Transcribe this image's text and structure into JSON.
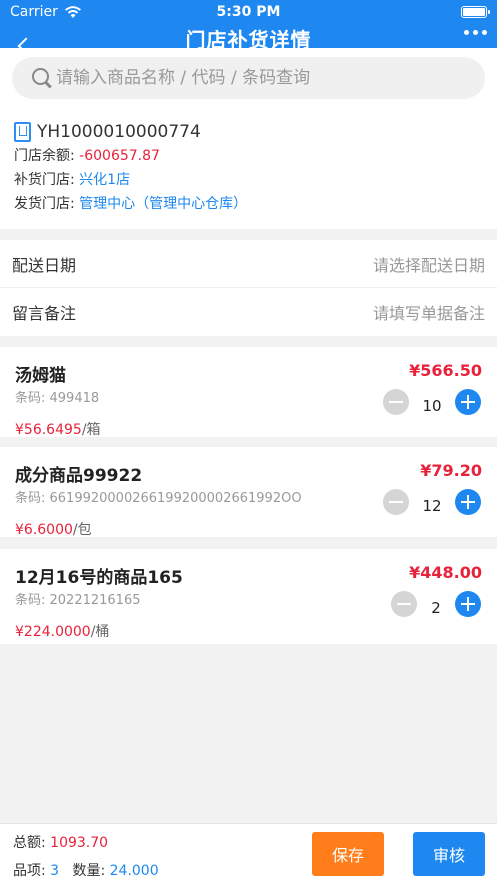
{
  "status_bar": {
    "carrier": "Carrier",
    "time": "5:30 PM"
  },
  "header": {
    "title": "门店补货详情"
  },
  "search": {
    "placeholder": "请输入商品名称 / 代码 / 条码查询"
  },
  "order": {
    "number": "YH1000010000774",
    "balance_label": "门店余额:",
    "balance_value": "-600657.87",
    "store_label": "补货门店:",
    "store_value": "兴化1店",
    "ship_label": "发货门店:",
    "ship_value": "管理中心（管理中心仓库）"
  },
  "fields": {
    "delivery_label": "配送日期",
    "delivery_placeholder": "请选择配送日期",
    "remark_label": "留言备注",
    "remark_placeholder": "请填写单据备注"
  },
  "items": [
    {
      "name": "汤姆猫",
      "code": "条码:  499418",
      "amount": "¥566.50",
      "unit_price": "¥56.6495",
      "unit": "/箱",
      "qty": "10"
    },
    {
      "name": "成分商品99922",
      "code": "条码:  6619920000266199200002661992OO",
      "amount": "¥79.20",
      "unit_price": "¥6.6000",
      "unit": "/包",
      "qty": "12"
    },
    {
      "name": "12月16号的商品165",
      "code": "条码:  20221216165",
      "amount": "¥448.00",
      "unit_price": "¥224.0000",
      "unit": "/桶",
      "qty": "2"
    }
  ],
  "footer": {
    "total_label": "总额:",
    "total_value": "1093.70",
    "items_label": "品项:",
    "items_value": "3",
    "qty_label": "数量:",
    "qty_value": "24.000",
    "save_label": "保存",
    "audit_label": "审核"
  },
  "colors": {
    "primary": "#1e88f0",
    "price_red": "#e8223a",
    "save_orange": "#ff7d1a"
  }
}
